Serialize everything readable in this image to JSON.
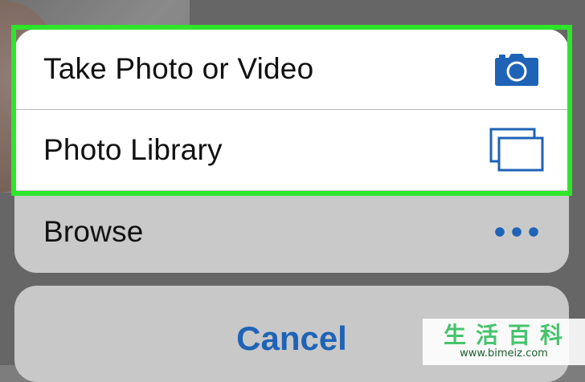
{
  "action_sheet": {
    "items": [
      {
        "label": "Take Photo or Video",
        "icon": "camera-icon"
      },
      {
        "label": "Photo Library",
        "icon": "photo-library-icon"
      },
      {
        "label": "Browse",
        "icon": "more-dots-icon"
      }
    ],
    "cancel_label": "Cancel"
  },
  "watermark": {
    "title": "生活百科",
    "url": "www.bimeiz.com"
  },
  "colors": {
    "accent_blue": "#1f63b6",
    "highlight_green": "#2ee52a"
  }
}
